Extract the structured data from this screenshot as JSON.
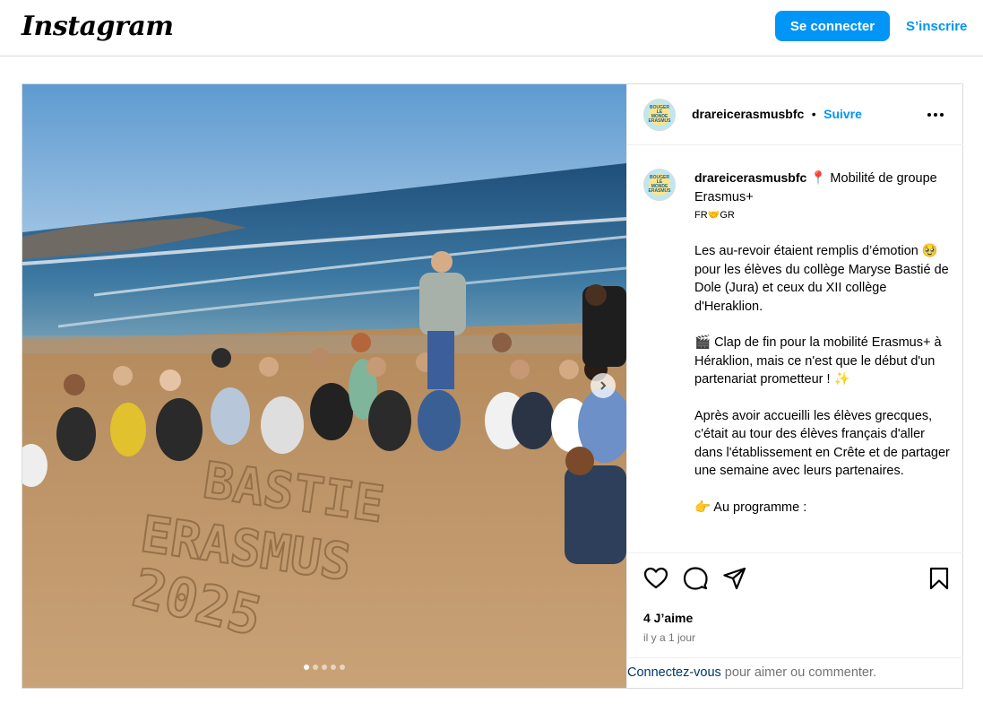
{
  "header": {
    "logo": "Instagram",
    "login_label": "Se connecter",
    "signup_label": "S’inscrire"
  },
  "post": {
    "username": "drareicerasmusbfc",
    "separator": "•",
    "follow_label": "Suivre",
    "avatar_text": "BOUGER LE MONDE ERASMUS",
    "caption": {
      "title_pin": "📍",
      "title_text": "Mobilité de groupe Erasmus+",
      "flags": "FR🤝GR",
      "paragraph1": "Les au-revoir étaient remplis d’émotion 🥹 pour les élèves du collège Maryse Bastié de Dole (Jura) et ceux du XII collège d'Heraklion.",
      "paragraph2": "🎬 Clap de fin pour la mobilité Erasmus+ à Héraklion, mais ce n'est que le début d'un partenariat prometteur ! ✨",
      "paragraph3": "Après avoir accueilli les élèves grecques, c'était au tour des élèves français d'aller dans l'établissement en Crête et de partager une semaine avec leurs partenaires.",
      "paragraph4": "👉 Au programme :"
    },
    "likes": "4 J’aime",
    "time": "il y a 1 jour",
    "login_prompt_link": "Connectez-vous",
    "login_prompt_rest": " pour aimer ou commenter.",
    "carousel": {
      "slides": 5,
      "current": 1
    },
    "sand_text_line1": "BASTIE",
    "sand_text_line2": "ERASMUS",
    "sand_text_line3": "2025"
  },
  "colors": {
    "accent": "#0095f6",
    "link_dark": "#00376b",
    "muted": "#737373",
    "border": "#dbdbdb"
  }
}
